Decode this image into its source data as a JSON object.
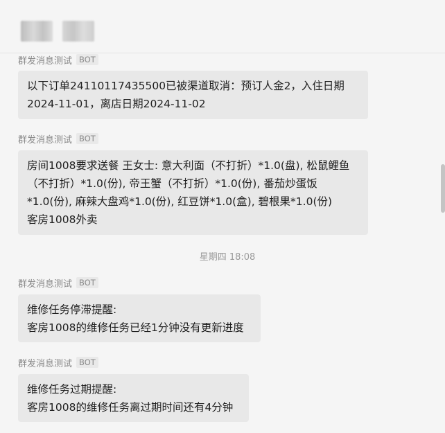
{
  "header": {
    "title_redacted": true
  },
  "messages": [
    {
      "sender": "群发消息测试",
      "badge": "BOT",
      "text": "以下订单24110117435500已被渠道取消：预订人金2，入住日期\n2024-11-01，离店日期2024-11-02"
    },
    {
      "sender": "群发消息测试",
      "badge": "BOT",
      "text": "房间1008要求送餐 王女士: 意大利面（不打折）*1.0(盘), 松鼠鲤鱼\n（不打折）*1.0(份), 帝王蟹（不打折）*1.0(份), 番茄炒蛋饭\n*1.0(份), 麻辣大盘鸡*1.0(份), 红豆饼*1.0(盒), 碧根果*1.0(份)\n客房1008外卖"
    },
    {
      "sender": "群发消息测试",
      "badge": "BOT",
      "text": "维修任务停滞提醒:\n客房1008的维修任务已经1分钟没有更新进度"
    },
    {
      "sender": "群发消息测试",
      "badge": "BOT",
      "text": "维修任务过期提醒:\n客房1008的维修任务离过期时间还有4分钟"
    }
  ],
  "timestamp": "星期四 18:08",
  "colors": {
    "background": "#f5f5f5",
    "bubble": "#e8e8e8",
    "meta_text": "#8a8a8a"
  }
}
